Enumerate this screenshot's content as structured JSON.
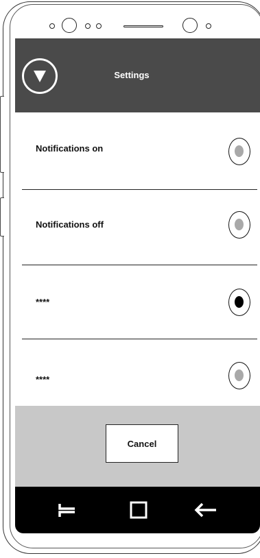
{
  "app_bar": {
    "title": "Settings",
    "menu_icon": "triangle-down-icon"
  },
  "settings": {
    "items": [
      {
        "label": "Notifications on",
        "selected": false
      },
      {
        "label": "Notifications off",
        "selected": false
      },
      {
        "label": "****",
        "selected": true
      },
      {
        "label": "****",
        "selected": false
      }
    ]
  },
  "actions": {
    "cancel_label": "Cancel"
  },
  "nav": {
    "recents_icon": "recents-icon",
    "home_icon": "square-home-icon",
    "back_icon": "back-arrow-icon"
  },
  "colors": {
    "app_bar": "#4a4a4a",
    "bottom_panel": "#c8c8c8",
    "nav_bar": "#000000",
    "radio_selected": "#000000",
    "radio_unselected": "#a9a9a9"
  }
}
